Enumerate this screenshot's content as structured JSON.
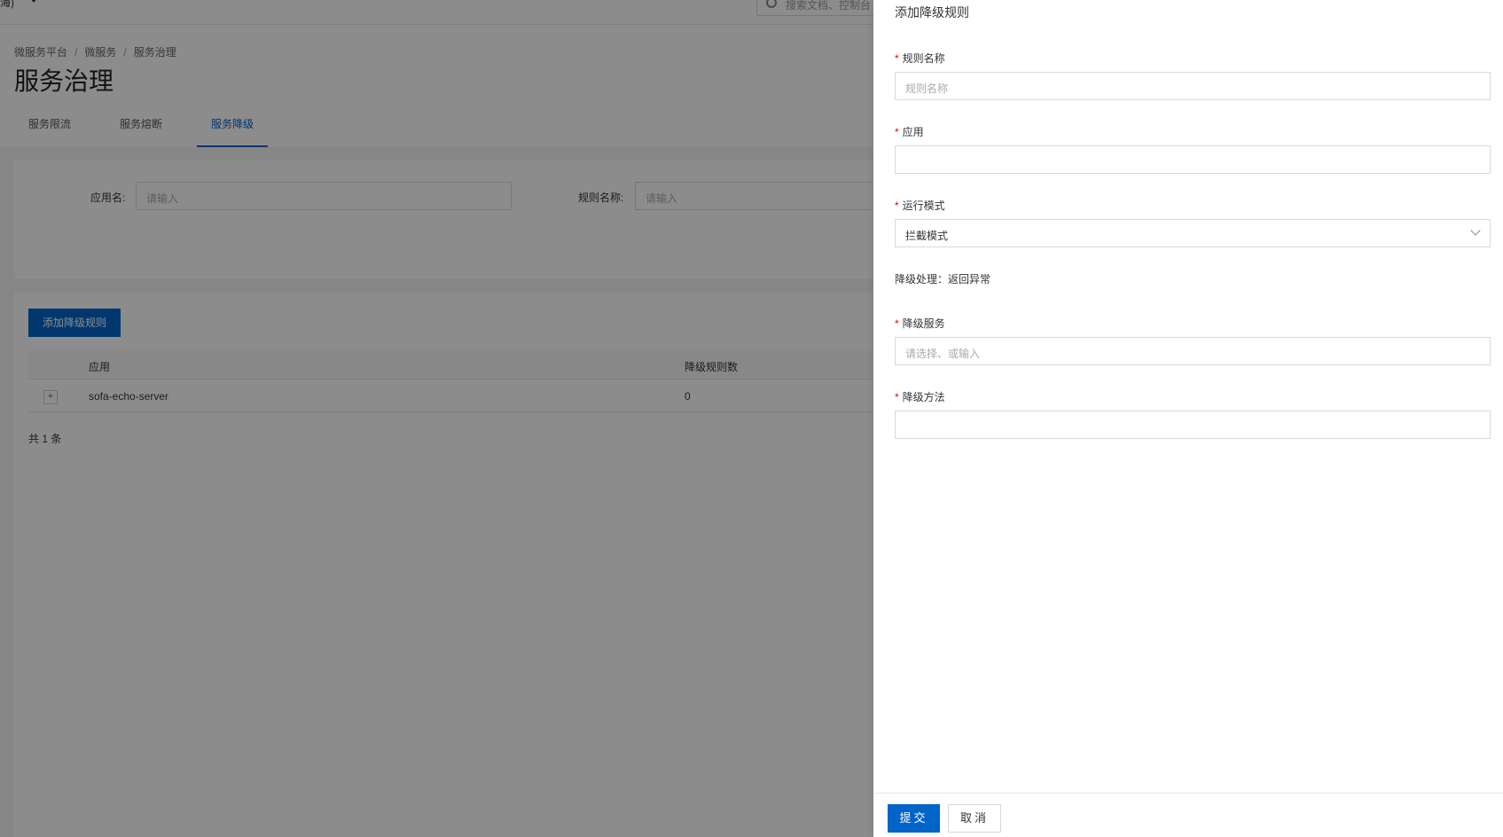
{
  "topbar": {
    "region": "海)",
    "search_placeholder": "搜索文档、控制台"
  },
  "breadcrumb": [
    "微服务平台",
    "微服务",
    "服务治理"
  ],
  "page_title": "服务治理",
  "tabs": [
    {
      "label": "服务限流"
    },
    {
      "label": "服务熔断"
    },
    {
      "label": "服务降级"
    }
  ],
  "filters": {
    "app_label": "应用名:",
    "app_placeholder": "请输入",
    "rule_label": "规则名称:",
    "rule_placeholder": "请输入"
  },
  "list": {
    "add_button": "添加降级规则",
    "columns": [
      "应用",
      "降级规则数"
    ],
    "rows": [
      {
        "expand": "+",
        "app": "sofa-echo-server",
        "count": "0"
      }
    ],
    "total": "共 1 条"
  },
  "drawer": {
    "title": "添加降级规则",
    "required_mark": "*",
    "fields": {
      "rule_name": {
        "label": "规则名称",
        "placeholder": "规则名称"
      },
      "app": {
        "label": "应用"
      },
      "run_mode": {
        "label": "运行模式",
        "value": "拦截模式"
      },
      "degrade_handling": "降级处理：返回异常",
      "degrade_service": {
        "label": "降级服务",
        "placeholder": "请选择、或输入"
      },
      "degrade_method": {
        "label": "降级方法"
      }
    },
    "submit": "提交",
    "cancel": "取消"
  }
}
